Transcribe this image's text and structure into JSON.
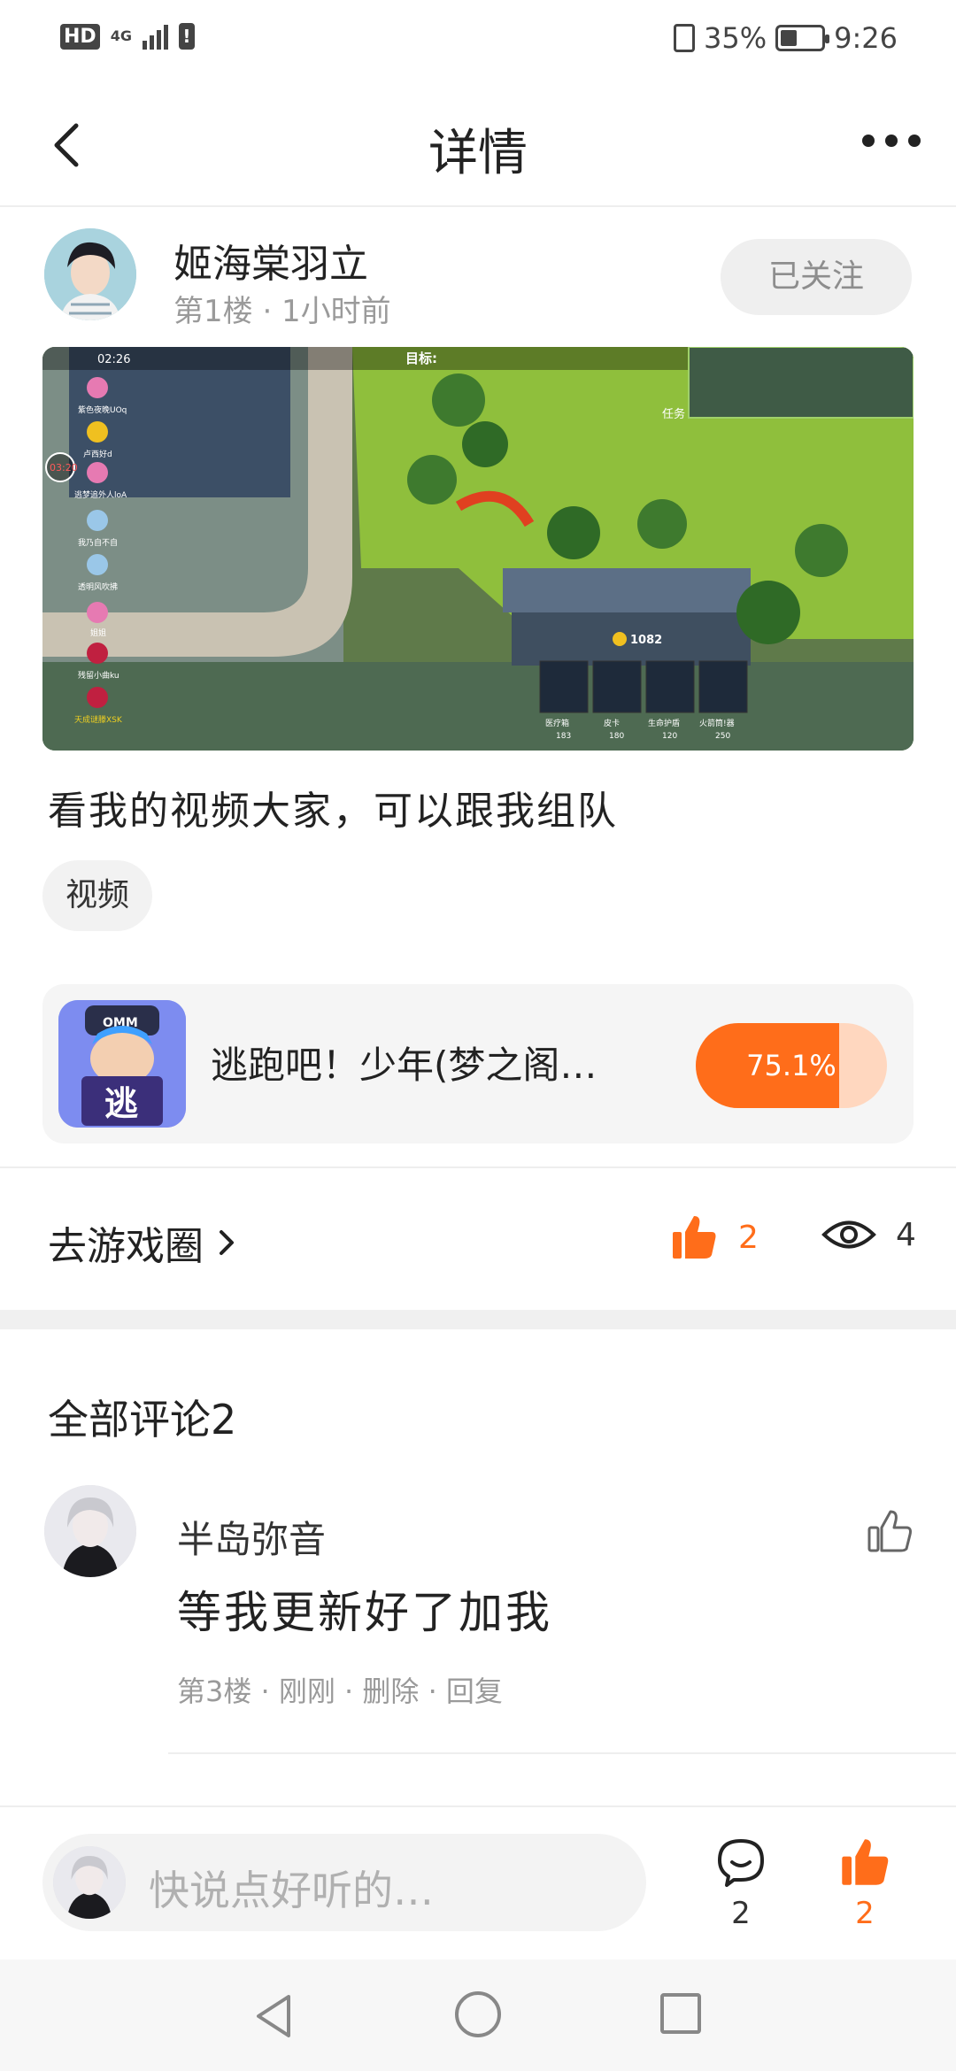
{
  "status_bar": {
    "hd": "HD",
    "network": "4G",
    "battery_percent": "35%",
    "time": "9:26"
  },
  "header": {
    "title": "详情"
  },
  "post": {
    "author_name": "姬海棠羽立",
    "meta": "第1楼 · 1小时前",
    "follow_label": "已关注",
    "text": "看我的视频大家，可以跟我组队",
    "tag": "视频",
    "video": {
      "time": "02:26",
      "objective_label": "目标:",
      "task_label": "任务",
      "coins": "1082",
      "timer": "03:20",
      "players": [
        "紫色夜晚UOq",
        "卢西好d",
        "逃梦追外人loA",
        "我乃自不自",
        "透明风吹拂",
        "姐姐",
        "残留小曲ku",
        "天成谜滕XSK"
      ],
      "items": [
        {
          "name": "医疗箱",
          "cost": "183"
        },
        {
          "name": "皮卡",
          "cost": "180"
        },
        {
          "name": "生命护盾",
          "cost": "120"
        },
        {
          "name": "火箭筒!器",
          "cost": "250"
        }
      ]
    }
  },
  "game_card": {
    "icon_text": "逃",
    "icon_cap_text": "OMM",
    "name": "逃跑吧！少年(梦之阁…",
    "percent_label": "75.1%",
    "percent_value": 0.751
  },
  "actions": {
    "goto_label": "去游戏圈",
    "like_count": "2",
    "view_count": "4"
  },
  "comments": {
    "title": "全部评论2",
    "items": [
      {
        "name": "半岛弥音",
        "text": "等我更新好了加我",
        "meta": "第3楼 · 刚刚 · 删除 · 回复"
      }
    ]
  },
  "bottom_bar": {
    "placeholder": "快说点好听的…",
    "comment_count": "2",
    "like_count": "2"
  },
  "colors": {
    "accent": "#ff6d1a",
    "accent_light": "#ffd7bf",
    "muted_text": "#9a9a9a"
  }
}
